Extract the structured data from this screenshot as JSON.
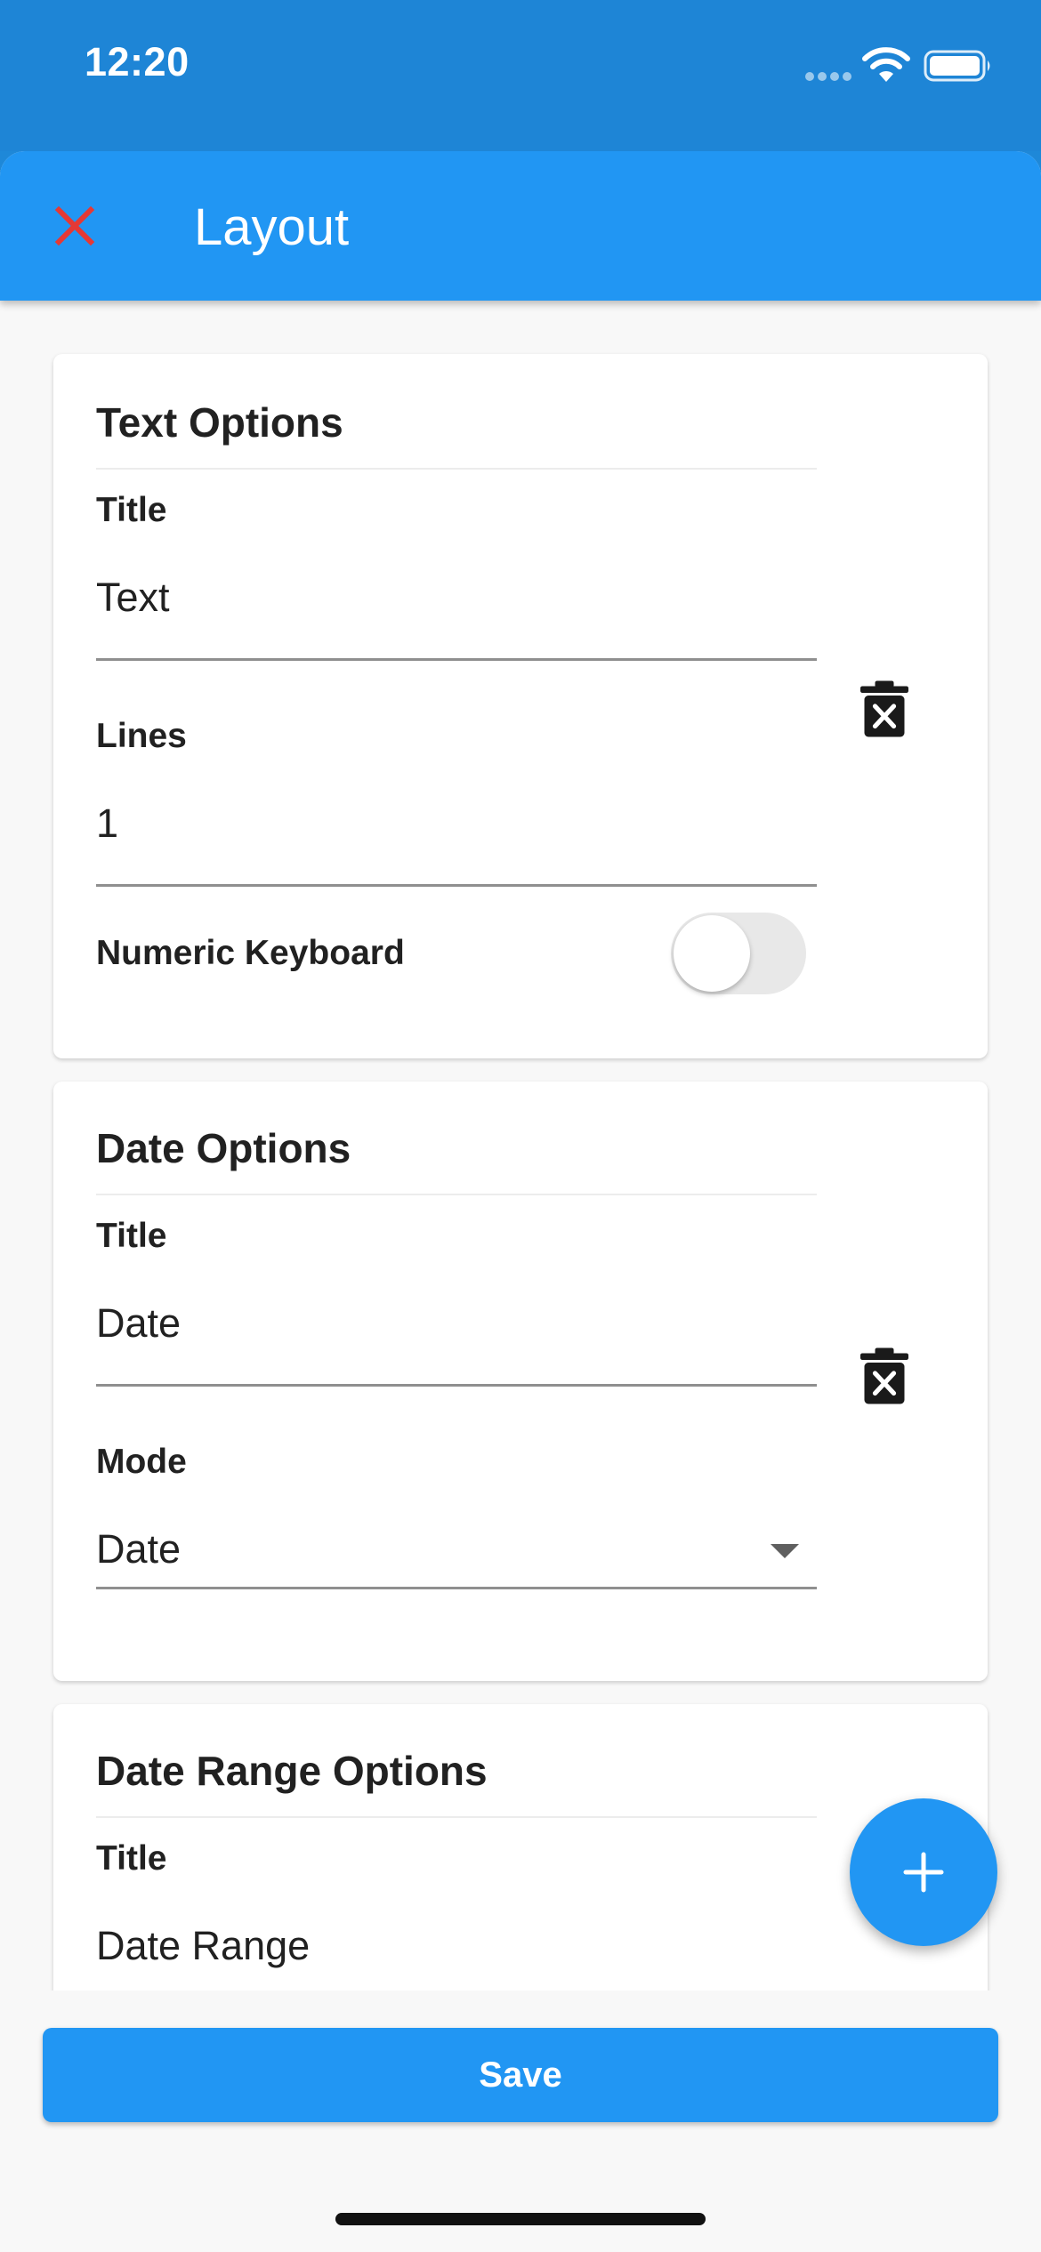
{
  "status_bar": {
    "time": "12:20"
  },
  "app_bar": {
    "title": "Layout",
    "close_icon": "close-icon",
    "close_color": "#e53935"
  },
  "colors": {
    "primary": "#2196f3",
    "status_bar": "#1e85d6",
    "background": "#f8f8f8"
  },
  "cards": {
    "text_options": {
      "heading": "Text Options",
      "title_label": "Title",
      "title_value": "Text",
      "lines_label": "Lines",
      "lines_value": "1",
      "numeric_keyboard_label": "Numeric Keyboard",
      "numeric_keyboard_on": false,
      "delete_icon": "trash-icon"
    },
    "date_options": {
      "heading": "Date Options",
      "title_label": "Title",
      "title_value": "Date",
      "mode_label": "Mode",
      "mode_value": "Date",
      "delete_icon": "trash-icon"
    },
    "date_range_options": {
      "heading": "Date Range Options",
      "title_label": "Title",
      "title_value": "Date Range"
    }
  },
  "fab": {
    "icon": "plus-icon"
  },
  "footer": {
    "save_label": "Save"
  }
}
